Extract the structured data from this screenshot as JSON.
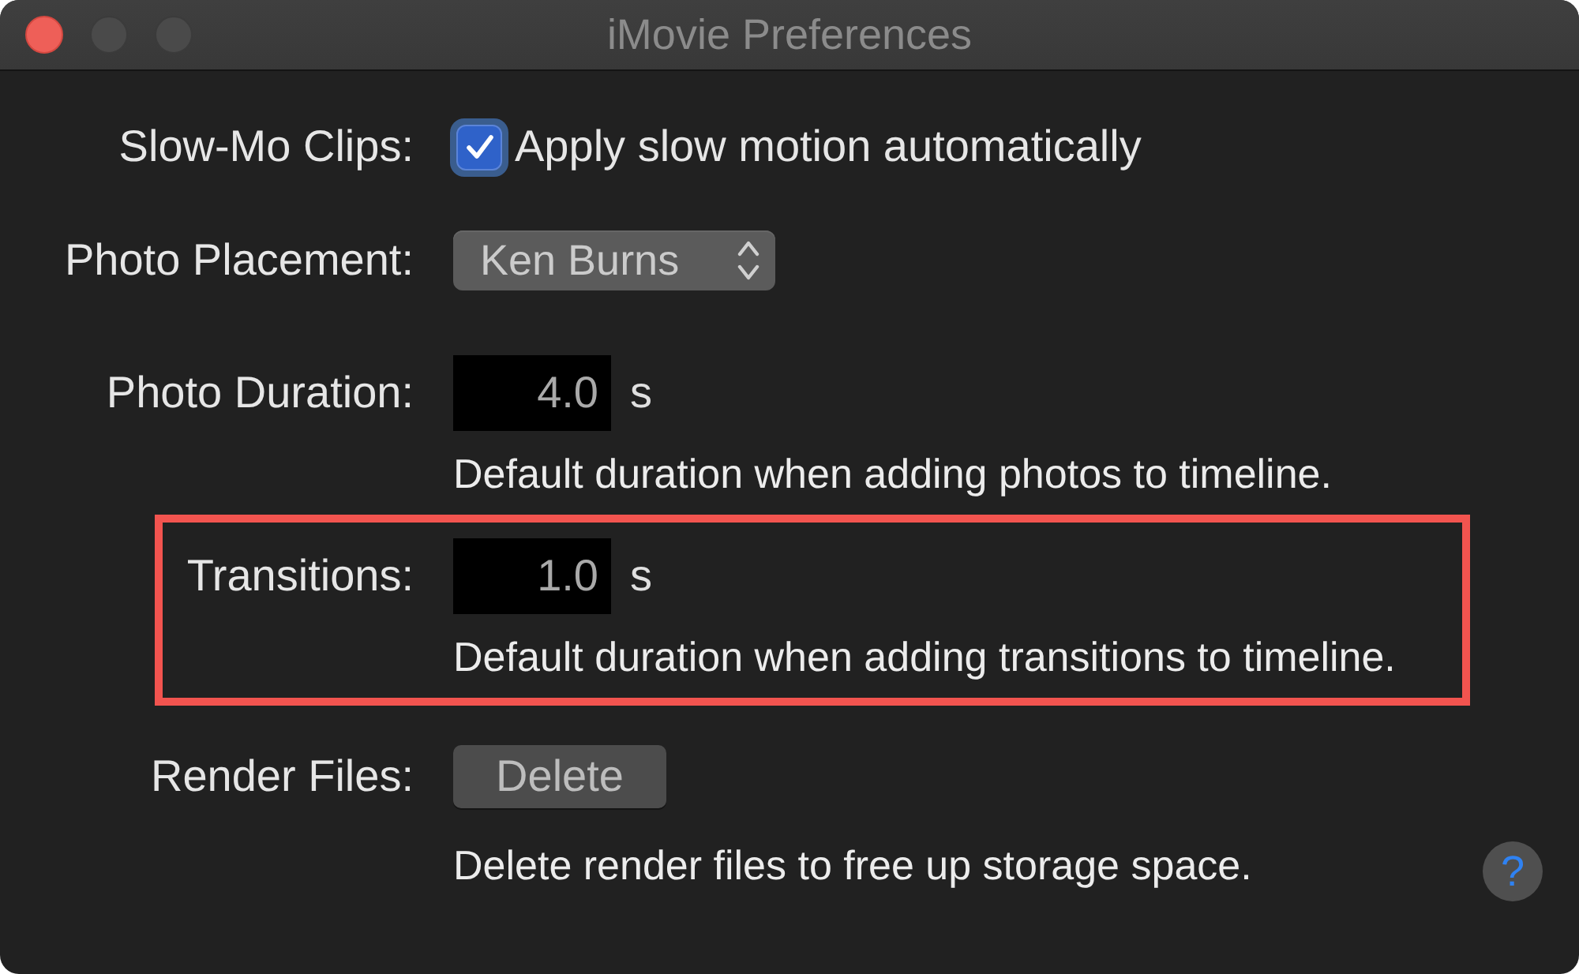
{
  "window": {
    "title": "iMovie Preferences",
    "traffic_lights": [
      {
        "kind": "close",
        "disabled": false
      },
      {
        "kind": "minimize",
        "disabled": true
      },
      {
        "kind": "zoom",
        "disabled": true
      }
    ]
  },
  "settings": [
    {
      "kind": "checkbox",
      "label": "Slow-Mo Clips:",
      "option": "Apply slow motion automatically",
      "checked": true,
      "highlighted": false
    },
    {
      "kind": "popup",
      "label": "Photo Placement:",
      "value": "Ken Burns",
      "highlighted": false
    },
    {
      "kind": "duration",
      "label": "Photo Duration:",
      "value": "4.0",
      "unit": "s",
      "description": "Default duration when adding photos to timeline.",
      "highlighted": false
    },
    {
      "kind": "duration",
      "label": "Transitions:",
      "value": "1.0",
      "unit": "s",
      "description": "Default duration when adding transitions to timeline.",
      "highlighted": true
    },
    {
      "kind": "button",
      "label": "Render Files:",
      "button": "Delete",
      "description": "Delete render files to free up storage space.",
      "highlighted": false
    }
  ],
  "help_button": {
    "label": "?"
  }
}
